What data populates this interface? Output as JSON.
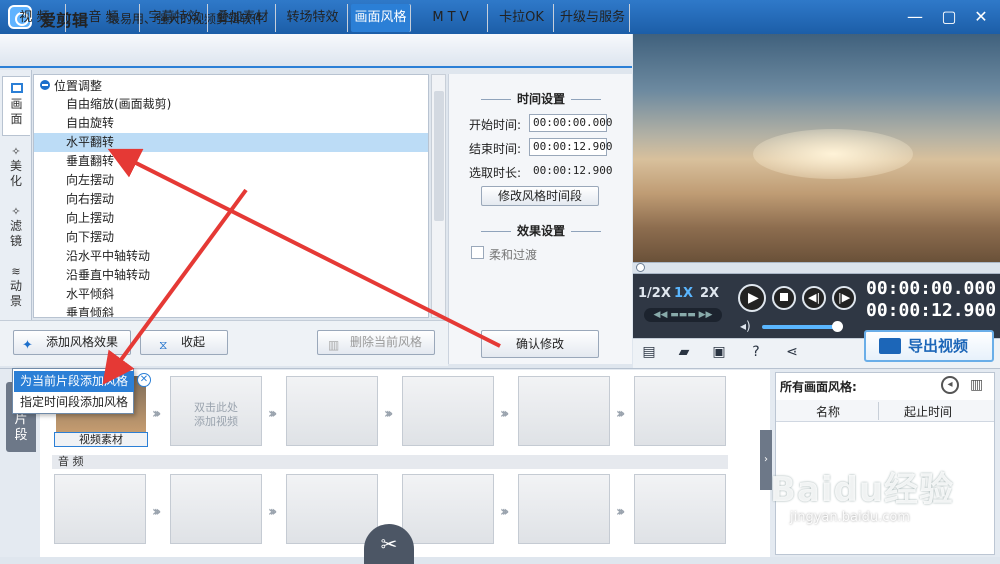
{
  "app": {
    "title": "爱剪辑",
    "slogan": "最易用、强大的视频剪辑软件"
  },
  "window_controls": {
    "minimize": "—",
    "maximize": "▢",
    "close": "✕"
  },
  "tabs": [
    {
      "label": "视  频",
      "active": false
    },
    {
      "label": "音  频",
      "active": false
    },
    {
      "label": "字幕特效",
      "active": false
    },
    {
      "label": "叠加素材",
      "active": false
    },
    {
      "label": "转场特效",
      "active": false
    },
    {
      "label": "画面风格",
      "active": true
    },
    {
      "label": "M T V",
      "active": false
    },
    {
      "label": "卡拉OK",
      "active": false
    },
    {
      "label": "升级与服务",
      "active": false
    }
  ],
  "side_tabs": [
    {
      "label": "画面",
      "active": true
    },
    {
      "label": "美化",
      "active": false
    },
    {
      "label": "滤镜",
      "active": false
    },
    {
      "label": "动景",
      "active": false
    }
  ],
  "effect_list": {
    "group": "位置调整",
    "items": [
      "自由缩放(画面裁剪)",
      "自由旋转",
      "水平翻转",
      "垂直翻转",
      "向左摆动",
      "向右摆动",
      "向上摆动",
      "向下摆动",
      "沿水平中轴转动",
      "沿垂直中轴转动",
      "水平倾斜",
      "垂直倾斜"
    ],
    "selected": "水平翻转"
  },
  "settings": {
    "time_title": "时间设置",
    "start_label": "开始时间:",
    "start_value": "00:00:00.000",
    "end_label": "结束时间:",
    "end_value": "00:00:12.900",
    "duration_label": "选取时长:",
    "duration_value": "00:00:12.900",
    "modify_time_button": "修改风格时间段",
    "effect_title": "效果设置",
    "smooth_label": "柔和过渡",
    "confirm_button": "确认修改"
  },
  "actions": {
    "add_effect": "添加风格效果",
    "collapse": "收起",
    "delete_effect": "删除当前风格"
  },
  "popup_menu": [
    "为当前片段添加风格",
    "指定时间段添加风格"
  ],
  "player": {
    "speeds": [
      "1/2X",
      "1X",
      "2X"
    ],
    "active_speed": "1X",
    "current_time": "00:00:00.000",
    "total_time": "00:00:12.900",
    "export_label": "导出视频"
  },
  "timeline": {
    "side_label": "片段",
    "video_clip_label": "视频素材",
    "add_video_hint": "双击此处\n添加视频",
    "audio_header": "音  频"
  },
  "styles_panel": {
    "title": "所有画面风格:",
    "col_name": "名称",
    "col_time": "起止时间"
  },
  "watermark": {
    "text": "Baidu经验",
    "url": "jingyan.baidu.com"
  },
  "colors": {
    "accent": "#2b7fd6",
    "titlebar": "#1c5ea8",
    "annotation": "#e53935"
  }
}
